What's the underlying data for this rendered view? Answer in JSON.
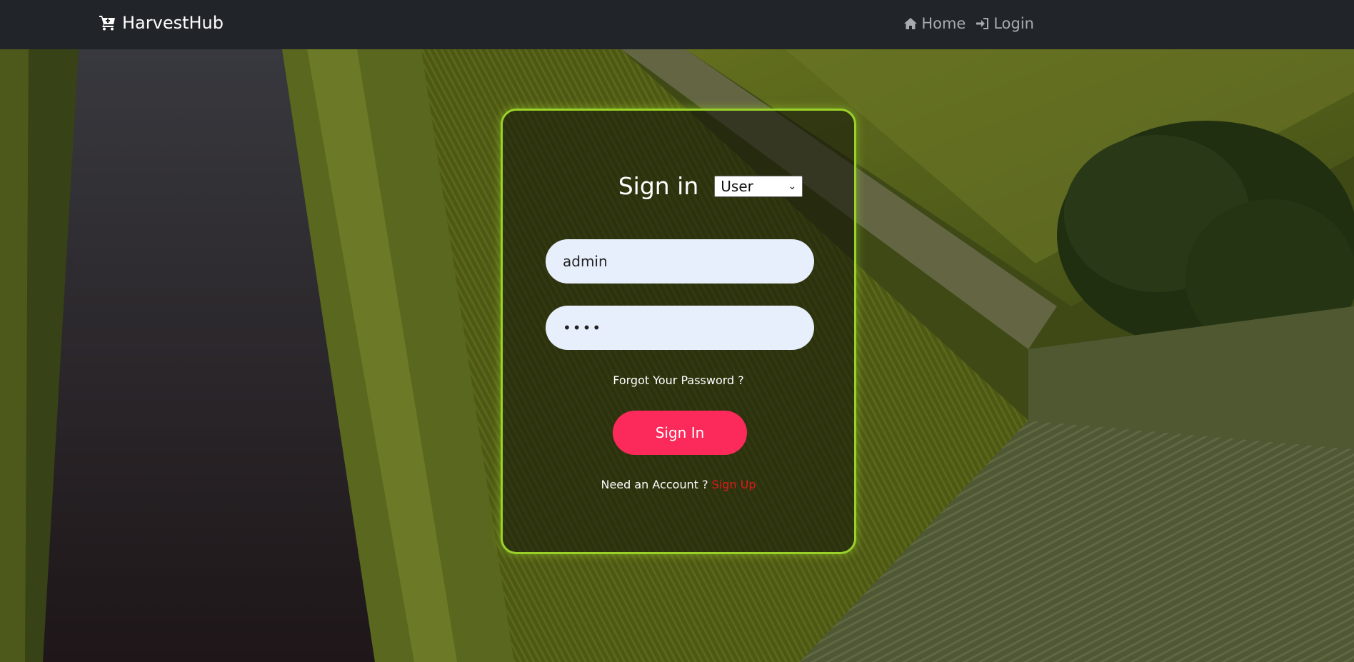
{
  "navbar": {
    "brand": "HarvestHub",
    "brand_icon": "cart-icon",
    "links": [
      {
        "label": "Home",
        "icon": "home-icon"
      },
      {
        "label": "Login",
        "icon": "sign-in-icon"
      }
    ]
  },
  "signin": {
    "title": "Sign in",
    "role_selected": "User",
    "username_value": "admin",
    "password_value": "••••",
    "forgot_label": "Forgot Your Password ?",
    "button_label": "Sign In",
    "account_prompt": "Need an Account ?",
    "signup_label": "Sign Up"
  },
  "colors": {
    "navbar_bg": "#212529",
    "card_border": "#9ad22a",
    "button_bg": "#fb2a5a",
    "signup_link": "#e0191b",
    "input_bg": "#e8effc"
  }
}
